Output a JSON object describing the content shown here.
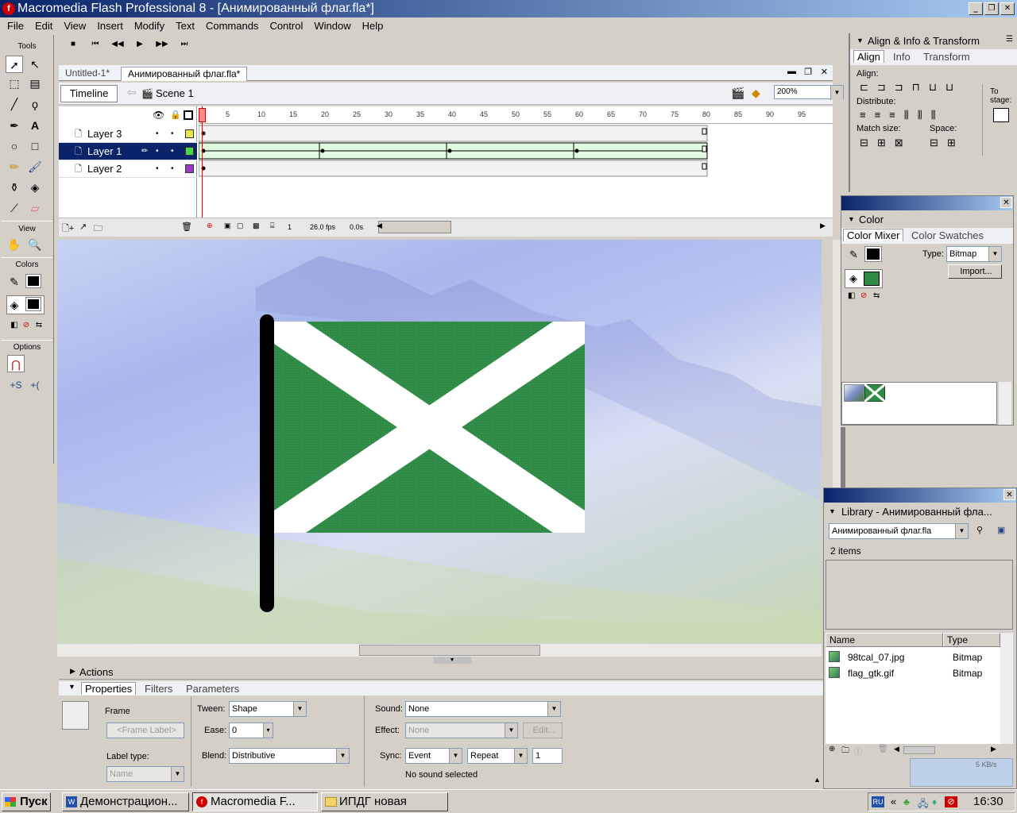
{
  "title": "Macromedia Flash Professional 8 - [Анимированный флаг.fla*]",
  "menu": [
    "File",
    "Edit",
    "View",
    "Insert",
    "Modify",
    "Text",
    "Commands",
    "Control",
    "Window",
    "Help"
  ],
  "tools": {
    "heading": "Tools",
    "view": "View",
    "colors": "Colors",
    "options": "Options"
  },
  "doc_tabs": [
    "Untitled-1*",
    "Анимированный флаг.fla*"
  ],
  "timeline": {
    "label": "Timeline",
    "scene": "Scene 1",
    "zoom": "200%",
    "layers": [
      {
        "name": "Layer 3",
        "color": "#e8e84a"
      },
      {
        "name": "Layer 1",
        "color": "#4ad84a",
        "selected": true
      },
      {
        "name": "Layer 2",
        "color": "#9a3ac8"
      }
    ],
    "ruler": [
      "1",
      "5",
      "10",
      "15",
      "20",
      "25",
      "30",
      "35",
      "40",
      "45",
      "50",
      "55",
      "60",
      "65",
      "70",
      "75",
      "80",
      "85",
      "90",
      "95"
    ],
    "current_frame": "1",
    "fps": "26.0 fps",
    "time": "0.0s"
  },
  "align_panel": {
    "title": "Align & Info & Transform",
    "tabs": [
      "Align",
      "Info",
      "Transform"
    ],
    "align": "Align:",
    "distribute": "Distribute:",
    "match_size": "Match size:",
    "space": "Space:",
    "to_stage": "To stage:"
  },
  "color_panel": {
    "title": "Color",
    "tabs": [
      "Color Mixer",
      "Color Swatches"
    ],
    "type_label": "Type:",
    "type_value": "Bitmap",
    "import": "Import..."
  },
  "library": {
    "title": "Library - Анимированный фла...",
    "file": "Анимированный флаг.fla",
    "count": "2 items",
    "col_name": "Name",
    "col_type": "Type",
    "items": [
      {
        "name": "98tcal_07.jpg",
        "type": "Bitmap"
      },
      {
        "name": "flag_gtk.gif",
        "type": "Bitmap"
      }
    ]
  },
  "properties": {
    "actions": "Actions",
    "tabs": [
      "Properties",
      "Filters",
      "Parameters"
    ],
    "frame": "Frame",
    "frame_label_placeholder": "<Frame Label>",
    "label_type": "Label type:",
    "label_type_value": "Name",
    "tween": "Tween:",
    "tween_value": "Shape",
    "ease": "Ease:",
    "ease_value": "0",
    "blend": "Blend:",
    "blend_value": "Distributive",
    "sound": "Sound:",
    "sound_value": "None",
    "effect": "Effect:",
    "effect_value": "None",
    "edit": "Edit...",
    "sync": "Sync:",
    "sync_value": "Event",
    "repeat_value": "Repeat",
    "repeat_count": "1",
    "no_sound": "No sound selected"
  },
  "taskbar": {
    "start": "Пуск",
    "tasks": [
      "Демонстрацион...",
      "Macromedia F...",
      "ИПДГ новая"
    ],
    "lang": "RU",
    "clock": "16:30",
    "net": "5 KB/s"
  },
  "colors": {
    "flag_green": "#2e8a45",
    "title_blue": "#0a246a"
  }
}
